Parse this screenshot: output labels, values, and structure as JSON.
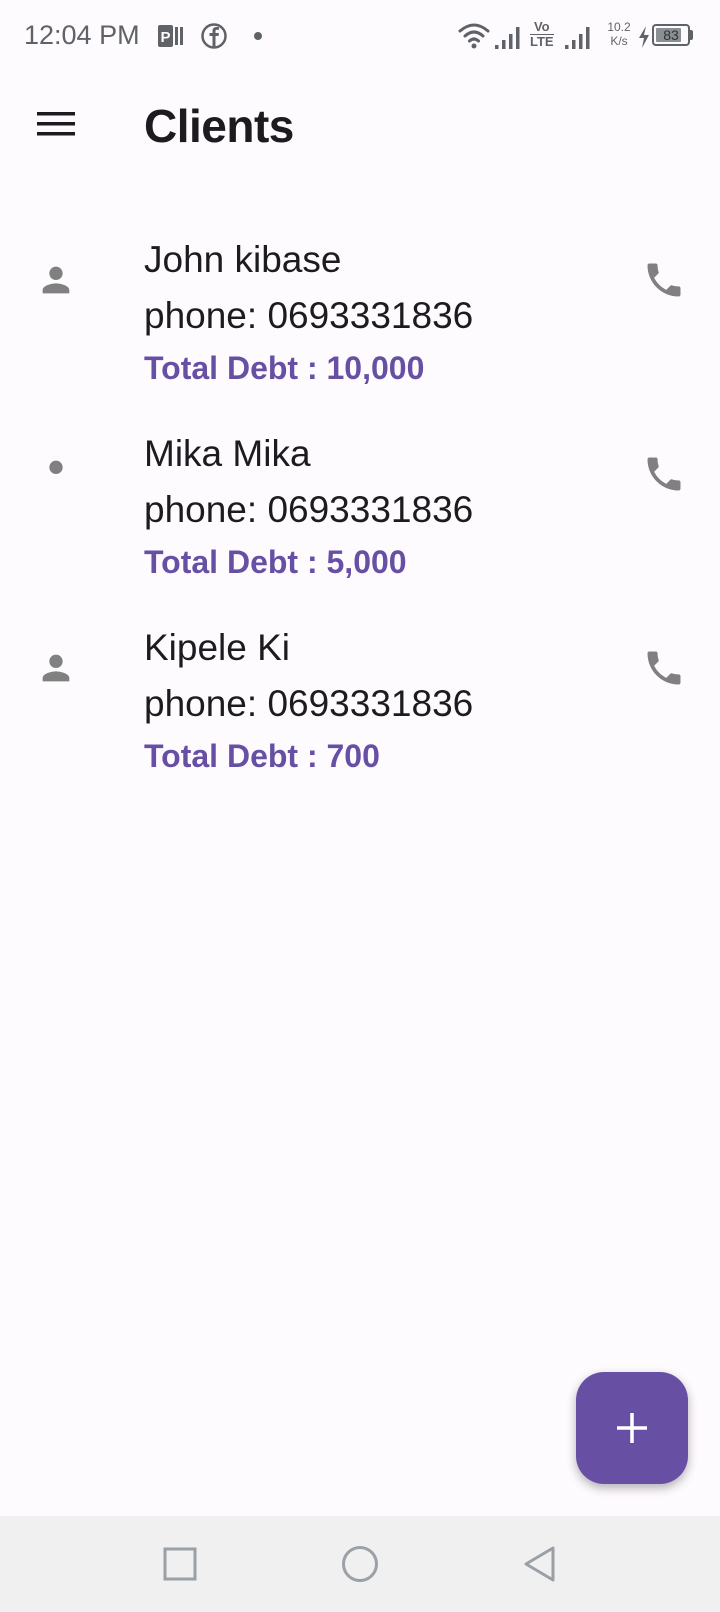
{
  "status_bar": {
    "time": "12:04 PM",
    "net_speed_value": "10.2",
    "net_speed_unit": "K/s",
    "volte_top": "Vo",
    "volte_bottom": "LTE",
    "battery_level": "83",
    "battery_fraction": 0.83,
    "icons": [
      "parking-app-icon",
      "facebook-icon",
      "notification-dot",
      "wifi-icon",
      "signal-icon",
      "volte-icon",
      "signal-icon-2",
      "charging-icon",
      "battery-icon"
    ]
  },
  "app_bar": {
    "title": "Clients",
    "menu_icon": "hamburger-menu-icon"
  },
  "clients": [
    {
      "name": "John kibase",
      "phone": "phone: 0693331836",
      "debt": "Total Debt : 10,000"
    },
    {
      "name": "Mika Mika",
      "phone": "phone: 0693331836",
      "debt": "Total Debt : 5,000"
    },
    {
      "name": "Kipele Ki",
      "phone": "phone: 0693331836",
      "debt": "Total Debt : 700"
    }
  ],
  "fab": {
    "icon": "plus-icon"
  },
  "nav_bar": {
    "icons": [
      "recent-apps-icon",
      "home-icon",
      "back-icon"
    ]
  },
  "colors": {
    "accent": "#6750a4",
    "background": "#fefbff",
    "icon_gray": "#808080",
    "nav_bar": "#f0f0f0"
  }
}
